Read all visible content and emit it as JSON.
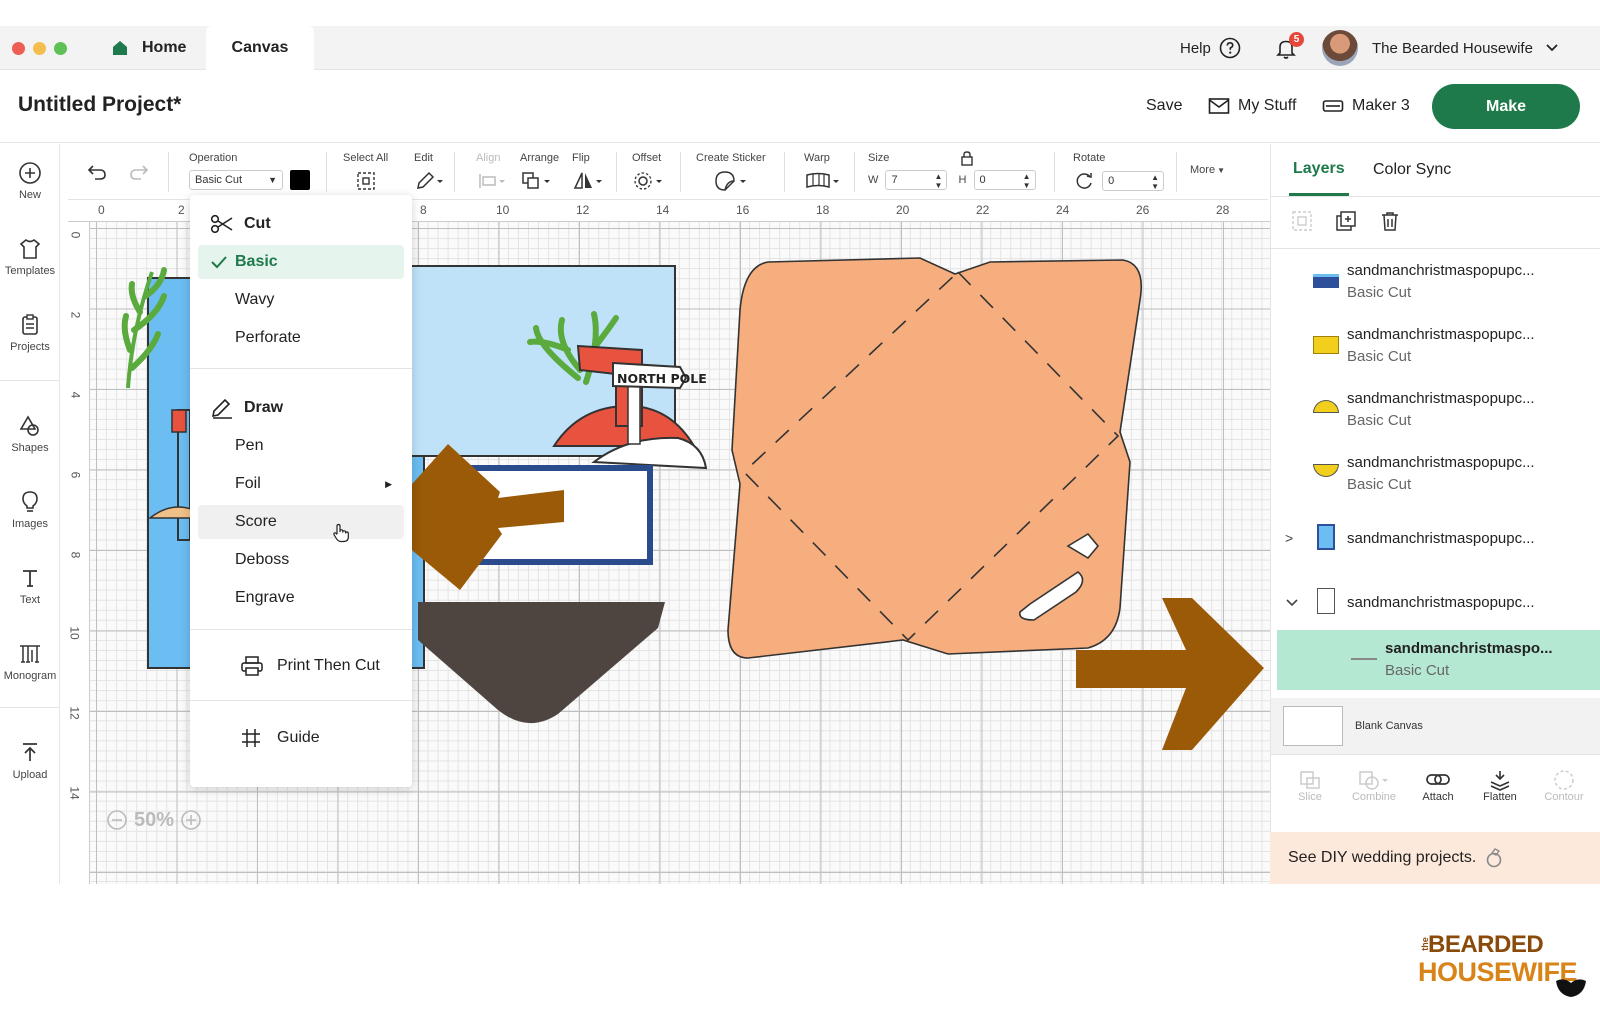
{
  "window": {
    "tabs": [
      {
        "label": "Home"
      },
      {
        "label": "Canvas"
      }
    ],
    "help_label": "Help",
    "notification_count": "5",
    "user_name": "The Bearded Housewife"
  },
  "project": {
    "title": "Untitled Project*",
    "save_label": "Save",
    "mystuff_label": "My Stuff",
    "machine_label": "Maker 3",
    "make_label": "Make"
  },
  "left_rail": {
    "items": [
      {
        "label": "New"
      },
      {
        "label": "Templates"
      },
      {
        "label": "Projects"
      },
      {
        "label": "Shapes"
      },
      {
        "label": "Images"
      },
      {
        "label": "Text"
      },
      {
        "label": "Monogram"
      },
      {
        "label": "Upload"
      }
    ]
  },
  "toolbar": {
    "operation_label": "Operation",
    "operation_value": "Basic Cut",
    "select_all_label": "Select All",
    "edit_label": "Edit",
    "align_label": "Align",
    "arrange_label": "Arrange",
    "flip_label": "Flip",
    "offset_label": "Offset",
    "create_sticker_label": "Create Sticker",
    "warp_label": "Warp",
    "size_label": "Size",
    "w_label": "W",
    "w_value": "7",
    "h_label": "H",
    "h_value": "0",
    "rotate_label": "Rotate",
    "rotate_value": "0",
    "more_label": "More"
  },
  "ruler": {
    "top": [
      "0",
      "2",
      "8",
      "10",
      "12",
      "14",
      "16",
      "18",
      "20",
      "22",
      "24",
      "26",
      "28"
    ],
    "left": [
      "0",
      "2",
      "4",
      "6",
      "8",
      "10",
      "12",
      "14"
    ]
  },
  "operation_menu": {
    "cut_header": "Cut",
    "cut_items": [
      {
        "label": "Basic"
      },
      {
        "label": "Wavy"
      },
      {
        "label": "Perforate"
      }
    ],
    "draw_header": "Draw",
    "draw_items": [
      {
        "label": "Pen"
      },
      {
        "label": "Foil"
      },
      {
        "label": "Score"
      },
      {
        "label": "Deboss"
      },
      {
        "label": "Engrave"
      }
    ],
    "print_then_cut": "Print Then Cut",
    "guide": "Guide",
    "selected": "Basic"
  },
  "canvas": {
    "sign_text": "NORTH POLE",
    "zoom": "50%"
  },
  "layers_panel": {
    "tabs": [
      {
        "label": "Layers"
      },
      {
        "label": "Color Sync"
      }
    ],
    "layers": [
      {
        "name": "sandmanchristmaspopupc...",
        "op": "Basic Cut",
        "swatch": "#2e4f9a"
      },
      {
        "name": "sandmanchristmaspopupc...",
        "op": "Basic Cut",
        "swatch": "#f2cf1d"
      },
      {
        "name": "sandmanchristmaspopupc...",
        "op": "Basic Cut",
        "swatch": "#f2cf1d"
      },
      {
        "name": "sandmanchristmaspopupc...",
        "op": "Basic Cut",
        "swatch": "#f2cf1d"
      }
    ],
    "groups": [
      {
        "name": "sandmanchristmaspopupc..."
      },
      {
        "name": "sandmanchristmaspopupc..."
      }
    ],
    "selected_layer": {
      "name": "sandmanchristmaspo...",
      "op": "Basic Cut"
    },
    "blank_canvas": "Blank Canvas",
    "bottom_tools": [
      {
        "label": "Slice"
      },
      {
        "label": "Combine"
      },
      {
        "label": "Attach"
      },
      {
        "label": "Flatten"
      },
      {
        "label": "Contour"
      }
    ]
  },
  "promo": {
    "text": "See DIY wedding projects."
  },
  "watermark": {
    "line1": "BEARDED",
    "line2": "HOUSEWIFE",
    "prefix": "the"
  },
  "colors": {
    "accent_green": "#1e7a4a",
    "selected_layer_bg": "#b5e8d3",
    "envelope": "#f6ae7f",
    "arrow": "#9a5a07",
    "sky": "#bfe2f8",
    "card_blue": "#6bbdf2",
    "navy": "#2a4b8c",
    "brown": "#4e4540",
    "red": "#e8533f",
    "leaf": "#5aaa3e",
    "promo_bg": "#fde9dc"
  }
}
